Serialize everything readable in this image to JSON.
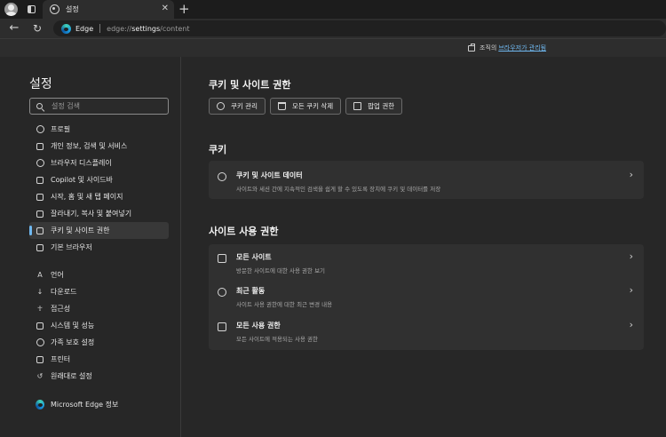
{
  "tab": {
    "title": "설정",
    "close": "✕",
    "new_tab": "+"
  },
  "toolbar": {
    "back": "←",
    "reload": "↻",
    "browser_name": "Edge",
    "url_prefix": "edge://",
    "url_bold": "settings",
    "url_suffix": "/content"
  },
  "managed": {
    "text": "조직의 ",
    "link": "브라우저가 관리됨"
  },
  "sidebar": {
    "title": "설정",
    "search_placeholder": "설정 검색",
    "items": [
      {
        "label": "프로필",
        "icon": "profile-icon"
      },
      {
        "label": "개인 정보, 검색 및 서비스",
        "icon": "lock-icon"
      },
      {
        "label": "브라우저 디스플레이",
        "icon": "palette-icon"
      },
      {
        "label": "Copilot 및 사이드바",
        "icon": "sidebar-icon"
      },
      {
        "label": "시작, 홈 및 새 탭 페이지",
        "icon": "home-icon"
      },
      {
        "label": "잘라내기, 복사 및 붙여넣기",
        "icon": "share-icon"
      },
      {
        "label": "쿠키 및 사이트 권한",
        "icon": "site-permissions-icon",
        "active": true
      },
      {
        "label": "기본 브라우저",
        "icon": "default-browser-icon"
      },
      {
        "label": "언어",
        "icon": "language-icon"
      },
      {
        "label": "다운로드",
        "icon": "download-icon"
      },
      {
        "label": "접근성",
        "icon": "accessibility-icon"
      },
      {
        "label": "시스템 및 성능",
        "icon": "system-icon"
      },
      {
        "label": "가족 보호 설정",
        "icon": "family-icon"
      },
      {
        "label": "프린터",
        "icon": "printer-icon"
      },
      {
        "label": "원래대로 설정",
        "icon": "reset-icon"
      },
      {
        "label": "Microsoft Edge 정보",
        "icon": "edge-icon"
      }
    ]
  },
  "main": {
    "title": "쿠키 및 사이트 권한",
    "buttons": [
      {
        "label": "쿠키 관리",
        "icon": "cookie-icon"
      },
      {
        "label": "모든 쿠키 삭제",
        "icon": "trash-icon"
      },
      {
        "label": "팝업 권한",
        "icon": "popup-icon"
      }
    ],
    "cookies_heading": "쿠키",
    "cookies_row": {
      "title": "쿠키 및 사이트 데이터",
      "desc": "사이트와 세션 간에 지속적인 검색을 쉽게 할 수 있도록 장치에 쿠키 및 데이터를 저장"
    },
    "site_heading": "사이트 사용 권한",
    "site_rows": [
      {
        "title": "모든 사이트",
        "desc": "방문한 사이트에 대한 사용 권한 보기"
      },
      {
        "title": "최근 활동",
        "desc": "사이트 사용 권한에 대한 최근 변경 내용"
      },
      {
        "title": "모든 사용 권한",
        "desc": "모든 사이트에 적용되는 사용 권한"
      }
    ],
    "chevron": "›"
  }
}
